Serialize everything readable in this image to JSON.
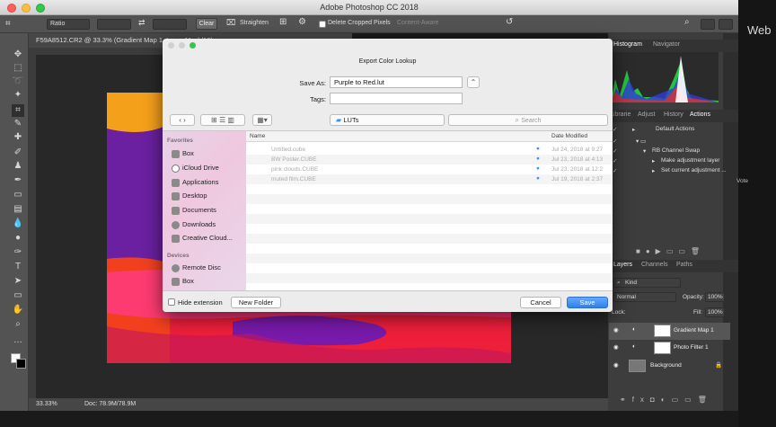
{
  "app": {
    "title": "Adobe Photoshop CC 2018",
    "right_label": "Web"
  },
  "options": {
    "ratio": "Ratio",
    "clear": "Clear",
    "straighten": "Straighten",
    "delete_cropped": "Delete Cropped Pixels",
    "content_aware": "Content-Aware"
  },
  "document": {
    "tab": "F59A8512.CR2 @ 33.3% (Gradient Map 1, Layer Mask/16)",
    "zoom": "33.33%",
    "doc_size": "Doc: 78.9M/78.9M"
  },
  "panels": {
    "top_tabs": [
      "Histogram",
      "Navigator"
    ],
    "mid_tabs": [
      "Librarie",
      "Adjust",
      "History",
      "Actions"
    ],
    "actions": [
      "Default Actions",
      "RB Channel Swap",
      "Make adjustment layer",
      "Set current adjustment ..."
    ],
    "layer_tabs": [
      "Layers",
      "Channels",
      "Paths"
    ],
    "kind": "Kind",
    "blend_mode": "Normal",
    "opacity_label": "Opacity:",
    "opacity": "100%",
    "lock_label": "Lock:",
    "fill_label": "Fill:",
    "fill": "100%",
    "layers": [
      "Gradient Map 1",
      "Photo Filter 1",
      "Background"
    ],
    "side_label": "Vote"
  },
  "dialog": {
    "title": "Export Color Lookup",
    "save_as_label": "Save As:",
    "save_as_value": "Purple to Red.lut",
    "tags_label": "Tags:",
    "location": "LUTs",
    "search_placeholder": "Search",
    "favorites_heading": "Favorites",
    "favorites": [
      "Box",
      "iCloud Drive",
      "Applications",
      "Desktop",
      "Documents",
      "Downloads",
      "Creative Cloud..."
    ],
    "devices_heading": "Devices",
    "devices": [
      "Remote Disc",
      "Box"
    ],
    "columns": {
      "name": "Name",
      "date": "Date Modified"
    },
    "files": [
      {
        "name": "Untitled.cube",
        "date": "Jul 24, 2018 at 9:27"
      },
      {
        "name": "BW Poster.CUBE",
        "date": "Jul 23, 2018 at 4:13"
      },
      {
        "name": "pink clouds.CUBE",
        "date": "Jul 23, 2018 at 12:2"
      },
      {
        "name": "muted film.CUBE",
        "date": "Jul 19, 2018 at 2:37"
      }
    ],
    "hide_extension": "Hide extension",
    "new_folder": "New Folder",
    "cancel": "Cancel",
    "save": "Save"
  },
  "colors": {
    "accent": "#3a8ef6",
    "canvas_red": "#ee1f3a",
    "canvas_purple": "#5a1aa8",
    "canvas_orange": "#f26a1b"
  }
}
